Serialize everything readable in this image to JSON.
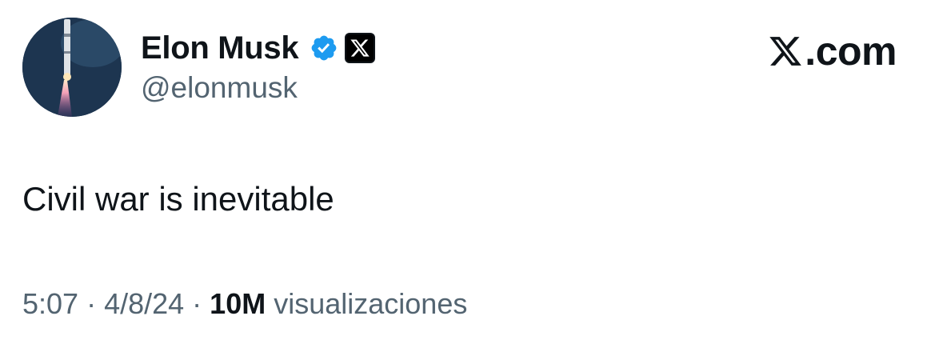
{
  "author": {
    "display_name": "Elon Musk",
    "handle": "@elonmusk",
    "verified_icon": "verified-badge-icon",
    "affiliate_icon": "x-logo-icon",
    "verified_color": "#1d9bf0"
  },
  "brand": {
    "logo_icon": "x-logo-icon",
    "suffix": ".com"
  },
  "tweet": {
    "text": "Civil war is inevitable"
  },
  "meta": {
    "time": "5:07",
    "separator": "·",
    "date": "4/8/24",
    "views_count": "10M",
    "views_label": "visualizaciones"
  },
  "colors": {
    "text_primary": "#0f1419",
    "text_secondary": "#536471",
    "background": "#ffffff"
  }
}
